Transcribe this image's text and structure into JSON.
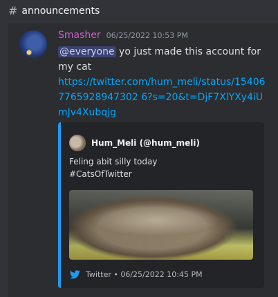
{
  "channel": {
    "name": "announcements"
  },
  "message": {
    "author": "Smasher",
    "timestamp": "06/25/2022 10:53 PM",
    "mention": "@everyone",
    "text": " yo just made this account for my cat",
    "link": "https://twitter.com/hum_meli/status/154067765928947302 6?s=20&t=DjF7XlYXy4iUmJv4Xubqjg"
  },
  "embed": {
    "author": "Hum_Meli (@hum_meli)",
    "line1": "Feling abit silly today",
    "line2": "#CatsOfTwitter",
    "footer": "Twitter • 06/25/2022 10:45 PM"
  },
  "colors": {
    "accent": "#1d9bf0",
    "author": "#d25ec7",
    "link": "#00a8fc",
    "background": "#313338"
  },
  "icons": {
    "channel": "hash-icon",
    "platform": "twitter-icon"
  }
}
